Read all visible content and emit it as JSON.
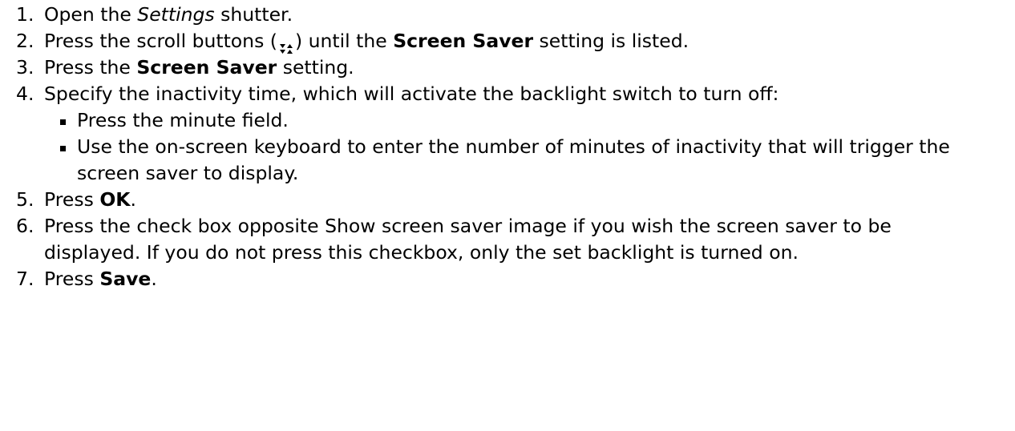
{
  "steps": [
    {
      "num": "1.",
      "t1": "Open the ",
      "italic": "Settings",
      "t2": " shutter."
    },
    {
      "num": "2.",
      "t1": "Press the scroll buttons (",
      "icon": "scroll-buttons-icon",
      "t2": ") until the ",
      "bold": "Screen Saver",
      "t3": " setting is listed."
    },
    {
      "num": "3.",
      "t1": "Press the ",
      "bold": "Screen Saver",
      "t2": " setting."
    },
    {
      "num": "4.",
      "text": "Specify the inactivity time, which will activate the backlight switch to turn off:",
      "sub": [
        "Press the minute field.",
        "Use the on-screen keyboard to enter the number of minutes of inactivity that will trigger the screen saver to display."
      ]
    },
    {
      "num": "5.",
      "t1": "Press ",
      "bold": "OK",
      "t2": "."
    },
    {
      "num": "6.",
      "text": "Press the check box opposite Show screen saver image if you wish the screen saver to be displayed. If you do not press this checkbox, only the set backlight is turned on."
    },
    {
      "num": "7.",
      "t1": "Press ",
      "bold": "Save",
      "t2": "."
    }
  ]
}
